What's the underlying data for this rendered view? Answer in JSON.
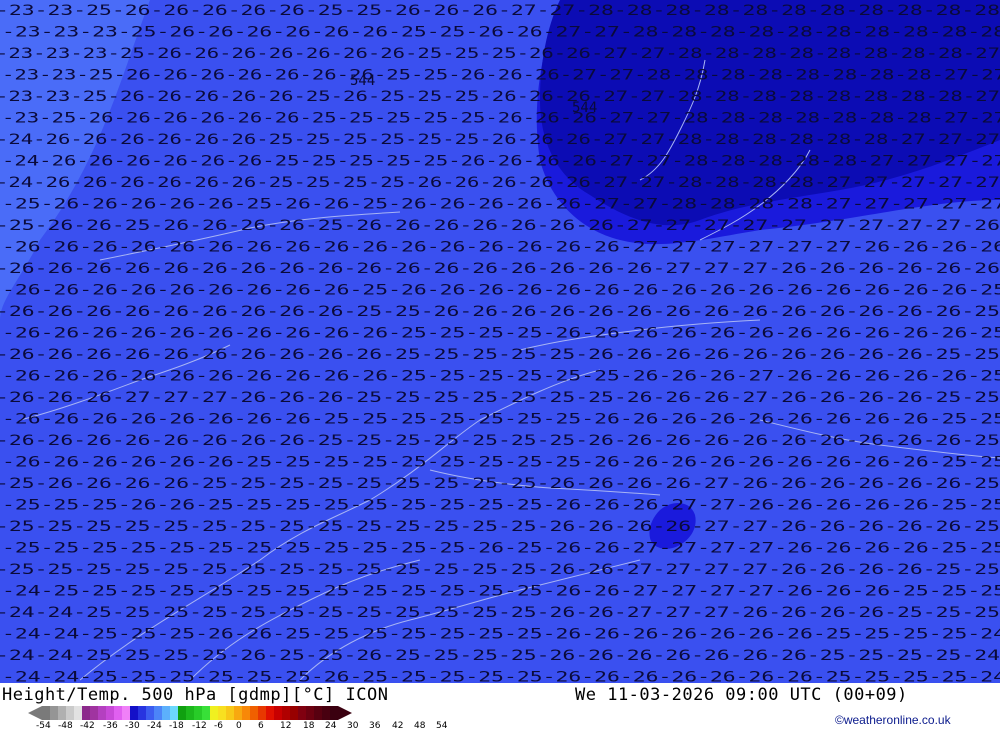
{
  "map": {
    "title": "Height/Temp. 500 hPa [gdmp][°C] ICON",
    "datetime": "We 11-03-2026 09:00 UTC (00+09)",
    "credit": "©weatheronline.co.uk",
    "height_labels": [
      "544",
      "544"
    ],
    "colors": {
      "field_main": "#3a50f0",
      "field_light": "#4a6cf8",
      "field_dark": "#1a1adc",
      "field_darkest": "#0c0cb4",
      "isotherm_text": "#0a0a3a",
      "coastline": "#a8b4f4"
    },
    "temperature_rows": [
      "-23-23-25-26-26-26-26-26-25-25-26-26-26-27-27-28-28-28-28-28-28-28-28-28-28-28",
      "-23-23-23-25-26-26-26-26-26-26-25-25-26-26-27-27-28-28-28-28-28-28-28-28-28-28",
      "-23-23-23-25-26-26-26-26-26-26-26-25-25-25-26-26-27-27-28-28-28-28-28-28-28-28-27",
      "-23-23-25-26-26-26-26-26-26-26-25-25-26-26-26-27-27-28-28-28-28-28-28-28-28-27-27",
      "-23-23-25-26-26-26-26-26-25-26-25-25-25-26-26-26-27-27-28-28-28-28-28-28-28-28-27",
      "-23-25-26-26-26-26-26-26-25-25-25-25-25-26-26-26-27-27-28-28-28-28-28-28-28-27-27",
      "-24-26-26-26-26-26-26-25-25-25-25-25-25-26-26-26-27-27-28-28-28-28-28-28-27-27-27",
      "-24-26-26-26-26-26-26-25-25-25-25-25-26-26-26-26-27-27-28-28-28-28-28-27-27-27-27",
      "-24-26-26-26-26-26-26-25-25-25-25-26-26-26-26-26-27-27-28-28-28-28-27-27-27-27-27",
      "-25-26-26-26-26-26-25-26-26-25-26-26-26-26-26-27-27-28-28-28-28-27-27-27-27-27",
      "-25-26-26-25-26-26-26-26-25-26-26-26-26-26-26-26-27-27-27-27-27-27-27-27-27-26",
      "-26-26-26-26-26-26-26-26-26-26-26-26-26-26-26-26-27-27-27-27-27-27-26-26-26-26",
      "-26-26-26-26-26-26-26-26-26-26-26-26-26-26-26-26-26-27-27-27-26-26-26-26-26-26",
      "-26-26-26-26-26-26-26-26-26-25-26-26-26-26-26-26-26-26-26-26-26-26-26-26-26-25",
      "-26-26-26-26-26-26-26-26-26-25-25-26-26-26-26-26-26-26-26-26-26-26-26-26-26-25",
      "-26-26-26-26-26-26-26-26-26-26-25-25-25-25-26-26-26-26-26-26-26-26-26-26-26-25",
      "-26-26-26-26-26-26-26-26-26-26-25-25-25-25-25-26-26-26-26-26-26-26-26-26-25-25",
      "-26-26-26-26-26-26-26-26-26-26-25-25-25-25-25-25-26-26-26-27-26-26-26-26-26-25",
      "-26-26-26-27-27-27-26-26-26-25-25-25-25-25-25-25-26-26-26-27-26-26-26-26-25-25",
      "-26-26-26-26-26-26-26-26-25-25-25-25-25-25-25-26-26-26-26-26-26-26-26-26-25-25",
      "-26-26-26-26-26-26-26-26-25-25-25-25-25-25-25-26-26-26-26-26-26-26-26-26-26-25",
      "-26-26-26-26-26-26-25-25-25-25-25-25-25-25-25-26-26-26-26-26-26-26-26-26-25-25",
      "-25-26-26-26-26-25-25-25-25-25-25-25-25-25-26-26-26-26-27-26-26-26-26-26-26-25",
      "-25-25-25-26-26-25-25-25-25-25-25-25-25-25-26-26-26-27-27-26-26-26-26-26-25-25",
      "-25-25-25-25-25-25-25-25-25-25-25-25-25-25-26-26-26-26-27-27-26-26-26-26-26-25",
      "-25-25-25-25-25-25-25-25-25-25-25-25-26-25-26-26-27-27-27-27-26-26-26-26-25-25",
      "-25-25-25-25-25-25-25-25-25-25-25-25-25-25-26-26-27-27-27-27-26-26-26-26-25-25",
      "-24-25-25-25-25-25-25-25-25-25-25-25-25-25-26-26-27-27-27-27-26-26-26-25-25-25",
      "-24-24-25-25-25-25-25-25-25-25-25-25-25-25-26-26-27-27-27-26-26-26-26-25-25-25",
      "-24-24-25-25-25-26-26-25-25-25-25-25-25-25-26-26-26-26-26-26-26-25-25-25-25-24",
      "-24-24-25-25-25-25-26-25-25-26-25-25-25-25-26-26-26-26-26-26-26-25-25-25-25-24",
      "-24-24-25-25-25-25-25-25-26-25-25-25-25-25-26-26-26-26-26-26-26-25-25-25-25-24"
    ],
    "legend": {
      "ticks": [
        "-54",
        "-48",
        "-42",
        "-36",
        "-30",
        "-24",
        "-18",
        "-12",
        "-6",
        "0",
        "6",
        "12",
        "18",
        "24",
        "30",
        "36",
        "42",
        "48",
        "54"
      ],
      "swatches": [
        "#7a7a7a",
        "#959595",
        "#b0b0b0",
        "#cbcbcb",
        "#e2e2e2",
        "#8c2a8c",
        "#a034a0",
        "#b440c0",
        "#c84ad8",
        "#e060f0",
        "#f080f8",
        "#1410c8",
        "#2834e0",
        "#3c5cf0",
        "#4c84f8",
        "#5cb0fc",
        "#6cd8fc",
        "#10a010",
        "#1cb81c",
        "#28cc28",
        "#38e038",
        "#f0f020",
        "#f8e020",
        "#f8c818",
        "#f8a810",
        "#f88808",
        "#f06000",
        "#e83800",
        "#e01000",
        "#c80000",
        "#b00000",
        "#980000",
        "#800010",
        "#6c0010",
        "#580010",
        "#480010",
        "#3a0010"
      ]
    }
  }
}
